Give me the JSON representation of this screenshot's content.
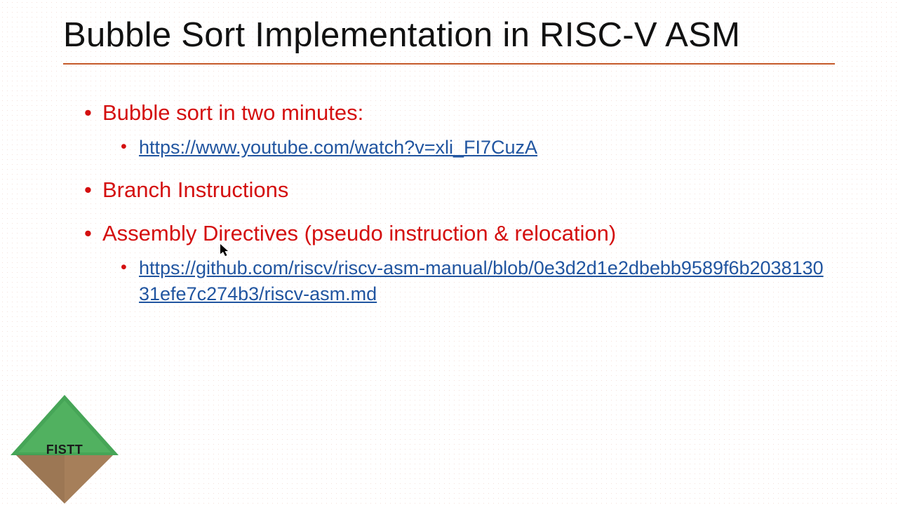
{
  "title": "Bubble Sort Implementation in RISC-V  ASM",
  "bullets": [
    {
      "text": "Bubble sort in two minutes:",
      "sub": [
        {
          "link": "https://www.youtube.com/watch?v=xli_FI7CuzA"
        }
      ]
    },
    {
      "text": "Branch Instructions",
      "sub": []
    },
    {
      "text": "Assembly Directives (pseudo instruction & relocation)",
      "sub": [
        {
          "link": "https://github.com/riscv/riscv-asm-manual/blob/0e3d2d1e2dbebb9589f6b203813031efe7c274b3/riscv-asm.md"
        }
      ]
    }
  ],
  "logo_text": "FISTT",
  "colors": {
    "accent_rule": "#c55a2a",
    "bullet_red": "#d40f0f",
    "link_blue": "#2155a0"
  }
}
